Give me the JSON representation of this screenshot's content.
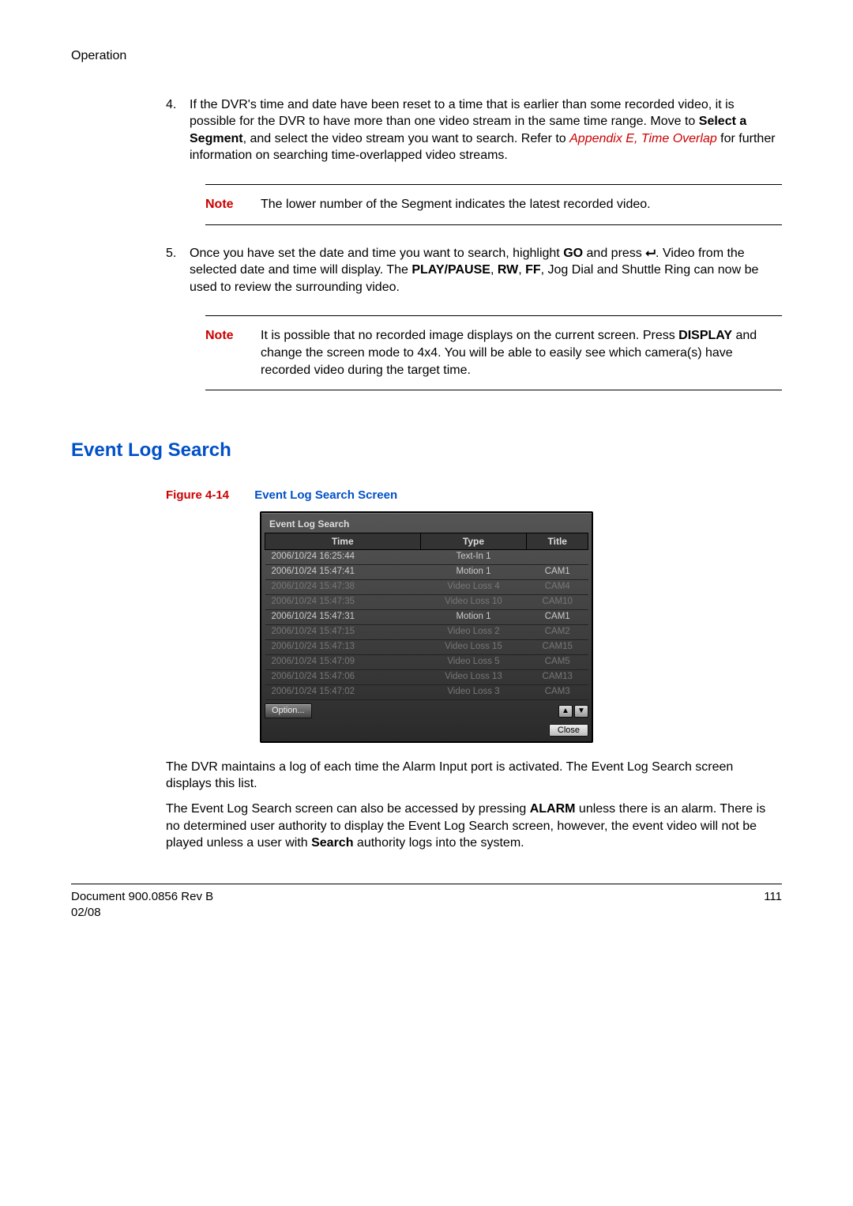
{
  "header": "Operation",
  "list": {
    "item4": {
      "num": "4.",
      "part1": "If the DVR's time and date have been reset to a time that is earlier than some recorded video, it is possible for the DVR to have more than one video stream in the same time range. Move to ",
      "bold1": "Select a Segment",
      "part2": ", and select the video stream you want to search. Refer to ",
      "link": "Appendix E, Time Overlap",
      "part3": " for further information on searching time-overlapped video streams."
    },
    "item5": {
      "num": "5.",
      "part1": "Once you have set the date and time you want to search, highlight ",
      "bold1": "GO",
      "part2": " and press ",
      "icon": "↵",
      "part3": ". Video from the selected date and time will display. The ",
      "bold2": "PLAY/PAUSE",
      "sep1": ", ",
      "bold3": "RW",
      "sep2": ", ",
      "bold4": "FF",
      "part4": ", Jog Dial and Shuttle Ring can now be used to review the surrounding video."
    }
  },
  "notes": {
    "label": "Note",
    "note1": "The lower number of the Segment indicates the latest recorded video.",
    "note2": {
      "p1": "It is possible that no recorded image displays on the current screen. Press ",
      "b1": "DISPLAY",
      "p2": " and change the screen mode to 4x4. You will be able to easily see which camera(s) have recorded video during the target time."
    }
  },
  "section_heading": "Event Log Search",
  "figure": {
    "label": "Figure 4-14",
    "title": "Event Log Search Screen"
  },
  "dvr": {
    "window_title": "Event Log Search",
    "headers": {
      "time": "Time",
      "type": "Type",
      "title": "Title"
    },
    "rows": [
      {
        "time": "2006/10/24  16:25:44",
        "type": "Text-In 1",
        "title": "",
        "dim": false
      },
      {
        "time": "2006/10/24  15:47:41",
        "type": "Motion 1",
        "title": "CAM1",
        "dim": false
      },
      {
        "time": "2006/10/24  15:47:38",
        "type": "Video Loss 4",
        "title": "CAM4",
        "dim": true
      },
      {
        "time": "2006/10/24  15:47:35",
        "type": "Video Loss 10",
        "title": "CAM10",
        "dim": true
      },
      {
        "time": "2006/10/24  15:47:31",
        "type": "Motion 1",
        "title": "CAM1",
        "dim": false
      },
      {
        "time": "2006/10/24  15:47:15",
        "type": "Video Loss 2",
        "title": "CAM2",
        "dim": true
      },
      {
        "time": "2006/10/24  15:47:13",
        "type": "Video Loss 15",
        "title": "CAM15",
        "dim": true
      },
      {
        "time": "2006/10/24  15:47:09",
        "type": "Video Loss 5",
        "title": "CAM5",
        "dim": true
      },
      {
        "time": "2006/10/24  15:47:06",
        "type": "Video Loss 13",
        "title": "CAM13",
        "dim": true
      },
      {
        "time": "2006/10/24  15:47:02",
        "type": "Video Loss 3",
        "title": "CAM3",
        "dim": true
      }
    ],
    "option_btn": "Option...",
    "close_btn": "Close"
  },
  "paras": {
    "p1": "The DVR maintains a log of each time the Alarm Input port is activated. The Event Log Search screen displays this list.",
    "p2": {
      "a": "The Event Log Search screen can also be accessed by pressing ",
      "b1": "ALARM",
      "b": " unless there is an alarm. There is no determined user authority to display the Event Log Search screen, however, the event video will not be played unless a user with ",
      "b2": "Search",
      "c": " authority logs into the system."
    }
  },
  "footer": {
    "left1": "Document 900.0856 Rev B",
    "left2": "02/08",
    "right": "111"
  }
}
